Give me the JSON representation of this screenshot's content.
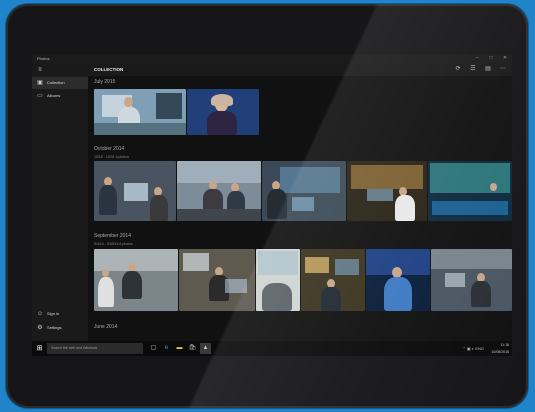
{
  "window": {
    "title": "Photos",
    "minimize": "–",
    "maximize": "□",
    "close": "✕"
  },
  "sidebar": {
    "menu_icon": "hamburger-icon",
    "items": [
      {
        "label": "Collection",
        "icon": "collection-icon",
        "active": true
      },
      {
        "label": "Albums",
        "icon": "albums-icon",
        "active": false
      }
    ],
    "bottom": [
      {
        "label": "Sign in",
        "icon": "person-icon"
      },
      {
        "label": "Settings",
        "icon": "gear-icon"
      }
    ]
  },
  "header": {
    "title": "COLLECTION",
    "tools": [
      "refresh-icon",
      "select-icon",
      "slideshow-icon",
      "more-icon"
    ]
  },
  "sections": [
    {
      "title": "July 2015",
      "subtitle": ""
    },
    {
      "title": "October 2014",
      "subtitle": "10/15 - 10/31   5 photos"
    },
    {
      "title": "September 2014",
      "subtitle": "9/4/14 - 9/30/14   6 photos"
    },
    {
      "title": "June 2014",
      "subtitle": ""
    }
  ],
  "taskbar": {
    "search_placeholder": "Search the web and Windows",
    "time": "11:18",
    "date": "10/05/2015",
    "tray_text": "ENG"
  },
  "colors": {
    "background": "#1f84c9",
    "screen": "#101010",
    "accent": "#0078d7"
  }
}
